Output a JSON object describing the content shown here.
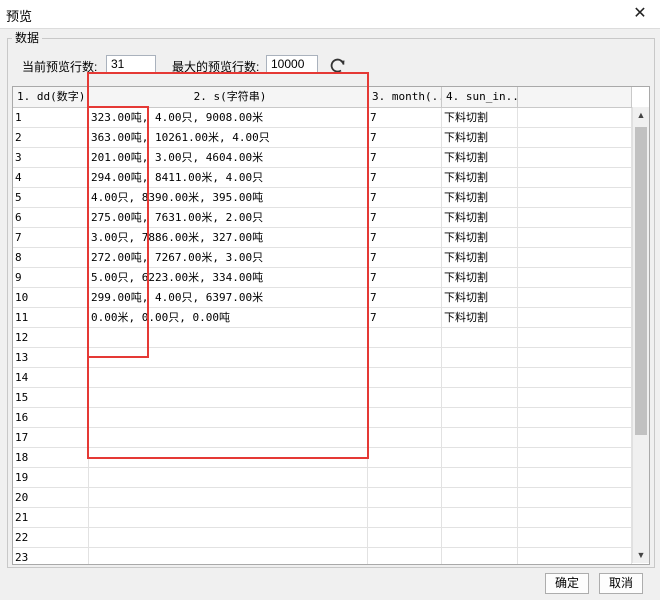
{
  "window": {
    "title": "预览",
    "close_glyph": "✕"
  },
  "group": {
    "label": "数据"
  },
  "preview": {
    "current_label": "当前预览行数:",
    "current_value": "31",
    "max_label": "最大的预览行数:",
    "max_value": "10000",
    "refresh_icon": "refresh-icon"
  },
  "table": {
    "headers": [
      "1. dd(数字)",
      "2. s(字符串)",
      "3. month(...",
      "4. sun_in...",
      ""
    ],
    "rows": [
      [
        "1",
        "323.00吨, 4.00只, 9008.00米",
        "7",
        "下料切割"
      ],
      [
        "2",
        "363.00吨, 10261.00米, 4.00只",
        "7",
        "下料切割"
      ],
      [
        "3",
        "201.00吨, 3.00只, 4604.00米",
        "7",
        "下料切割"
      ],
      [
        "4",
        "294.00吨, 8411.00米, 4.00只",
        "7",
        "下料切割"
      ],
      [
        "5",
        "4.00只, 8390.00米, 395.00吨",
        "7",
        "下料切割"
      ],
      [
        "6",
        "275.00吨, 7631.00米, 2.00只",
        "7",
        "下料切割"
      ],
      [
        "7",
        "3.00只, 7886.00米, 327.00吨",
        "7",
        "下料切割"
      ],
      [
        "8",
        "272.00吨, 7267.00米, 3.00只",
        "7",
        "下料切割"
      ],
      [
        "9",
        "5.00只, 6223.00米, 334.00吨",
        "7",
        "下料切割"
      ],
      [
        "10",
        "299.00吨, 4.00只, 6397.00米",
        "7",
        "下料切割"
      ],
      [
        "11",
        "0.00米, 0.00只, 0.00吨",
        "7",
        "下料切割"
      ],
      [
        "12",
        "",
        "",
        ""
      ],
      [
        "13",
        "",
        "",
        ""
      ],
      [
        "14",
        "",
        "",
        ""
      ],
      [
        "15",
        "",
        "",
        ""
      ],
      [
        "16",
        "",
        "",
        ""
      ],
      [
        "17",
        "",
        "",
        ""
      ],
      [
        "18",
        "",
        "",
        ""
      ],
      [
        "19",
        "",
        "",
        ""
      ],
      [
        "20",
        "",
        "",
        ""
      ],
      [
        "21",
        "",
        "",
        ""
      ],
      [
        "22",
        "",
        "",
        ""
      ],
      [
        "23",
        "",
        "",
        ""
      ]
    ]
  },
  "buttons": {
    "ok": "确定",
    "cancel": "取消"
  },
  "colors": {
    "annotation": "#e53935",
    "grid_background": "#ffffff",
    "window_background": "#f0f0f0"
  }
}
